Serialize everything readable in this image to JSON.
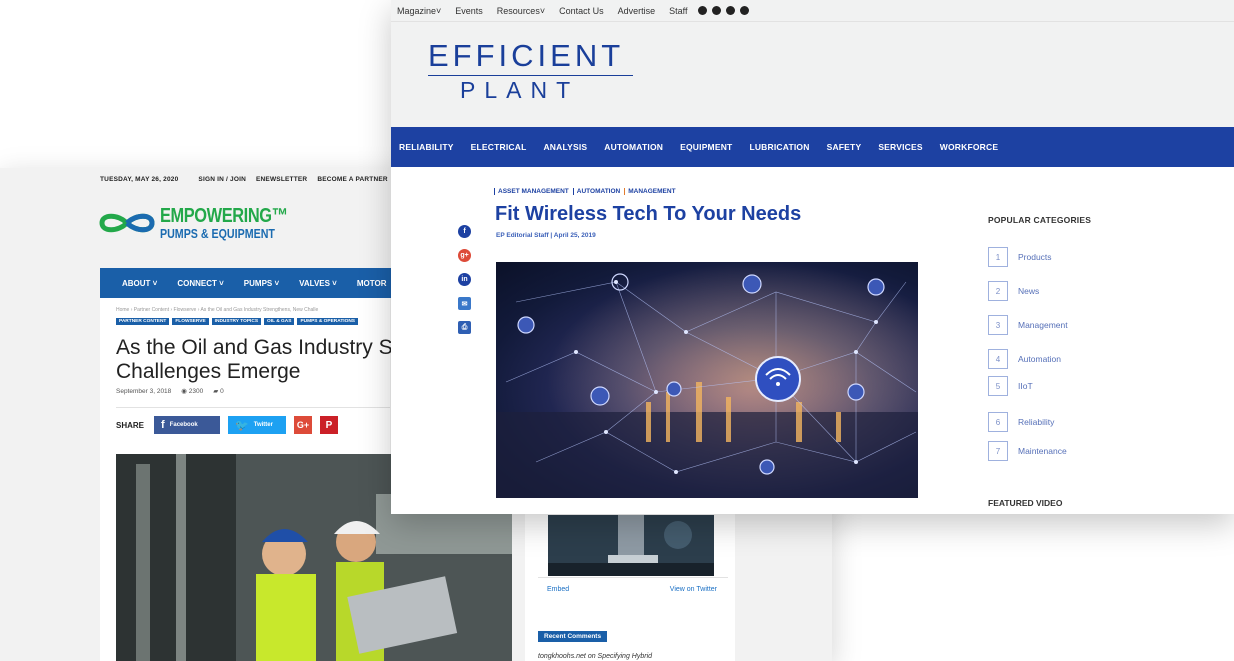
{
  "pumps": {
    "topbar": [
      "TUESDAY, MAY 26, 2020",
      "SIGN IN / JOIN",
      "ENEWSLETTER",
      "BECOME A PARTNER"
    ],
    "logo": {
      "line1": "EMPOWERING™",
      "line2": "PUMPS & EQUIPMENT"
    },
    "nav": [
      "ABOUT ˅",
      "CONNECT ˅",
      "PUMPS ˅",
      "VALVES ˅",
      "MOTOR"
    ],
    "breadcrumb": "Home › Partner Content › Flowserve › As the Oil and Gas Industry Strengthens, New Challe",
    "tags": [
      "PARTNER CONTENT",
      "FLOWSERVE",
      "INDUSTRY TOPICS",
      "OIL & GAS",
      "PUMPS & OPERATIONS"
    ],
    "title": "As the Oil and Gas Industry Stre New Challenges Emerge",
    "meta": {
      "date": "September 3, 2018",
      "views": "2300",
      "comments": "0"
    },
    "share": {
      "label": "SHARE",
      "facebook": "Facebook",
      "twitter": "Twitter",
      "google": "G+",
      "pinterest": "P"
    },
    "sidebar": {
      "embed": "Embed",
      "view_twitter": "View on Twitter",
      "recent_label": "Recent Comments",
      "recent_text": "tongkhoohs.net on Specifying Hybrid"
    }
  },
  "ep": {
    "topbar": [
      "Magazine˅",
      "Events",
      "Resources˅",
      "Contact Us",
      "Advertise",
      "Staff"
    ],
    "logo": {
      "line1": "EFFICIENT",
      "line2": "PLANT"
    },
    "nav": [
      "RELIABILITY",
      "ELECTRICAL",
      "ANALYSIS",
      "AUTOMATION",
      "EQUIPMENT",
      "LUBRICATION",
      "SAFETY",
      "SERVICES",
      "WORKFORCE"
    ],
    "categories": [
      "ASSET MANAGEMENT",
      "AUTOMATION",
      "MANAGEMENT"
    ],
    "title": "Fit Wireless Tech To Your Needs",
    "byline": "EP Editorial Staff | April 25, 2019",
    "popular": {
      "header": "POPULAR CATEGORIES",
      "items": [
        {
          "num": "1",
          "label": "Products"
        },
        {
          "num": "2",
          "label": "News"
        },
        {
          "num": "3",
          "label": "Management"
        },
        {
          "num": "4",
          "label": "Automation"
        },
        {
          "num": "5",
          "label": "IIoT"
        },
        {
          "num": "6",
          "label": "Reliability"
        },
        {
          "num": "7",
          "label": "Maintenance"
        }
      ]
    },
    "featured": "FEATURED VIDEO"
  }
}
